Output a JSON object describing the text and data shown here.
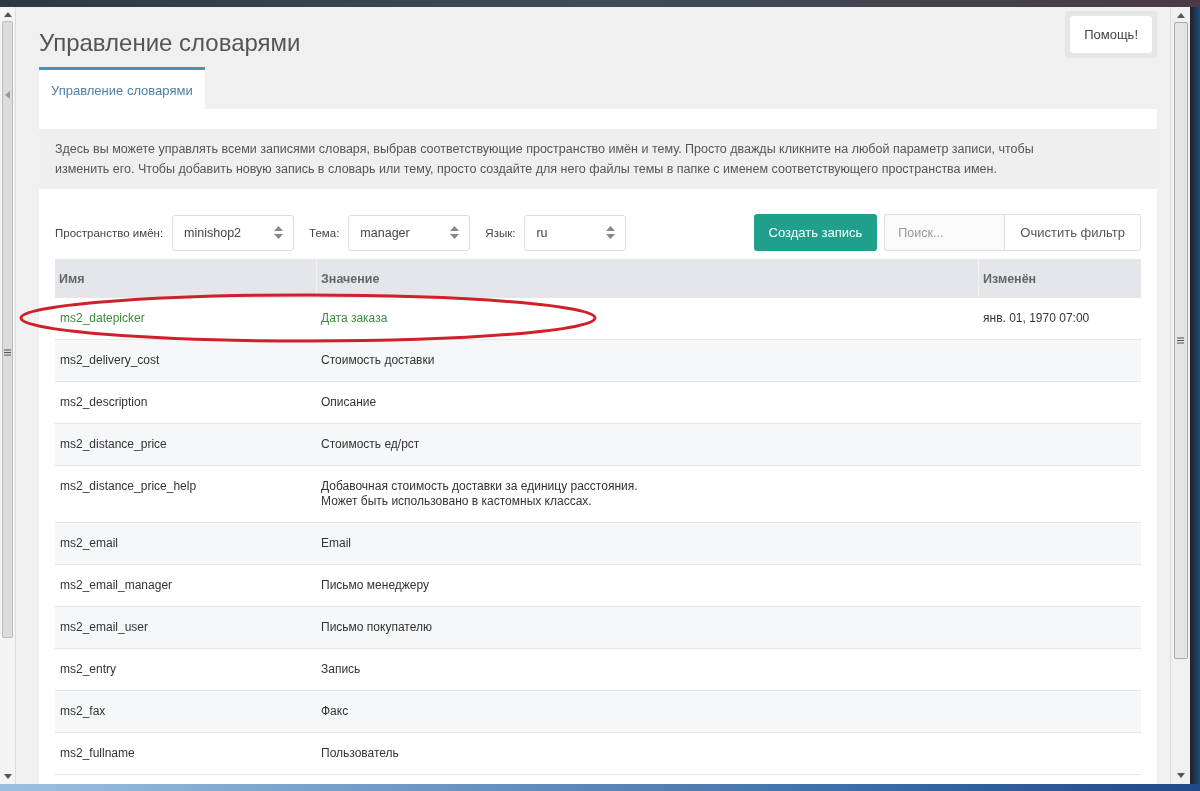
{
  "page": {
    "title": "Управление словарями",
    "help_button": "Помощь!"
  },
  "tabs": [
    {
      "label": "Управление словарями",
      "selected": true
    }
  ],
  "info": "Здесь вы можете управлять всеми записями словаря, выбрав соответствующие пространство имён и тему. Просто дважды кликните на любой параметр записи, чтобы изменить его. Чтобы добавить новую запись в словарь или тему, просто создайте для него файлы темы в папке с именем соответствующего пространства имен.",
  "filters": [
    {
      "label": "Пространство имён:",
      "value": "minishop2"
    },
    {
      "label": "Тема:",
      "value": "manager"
    },
    {
      "label": "Язык:",
      "value": "ru"
    }
  ],
  "create_button": "Создать запись",
  "search": {
    "placeholder": "Поиск..."
  },
  "clear_button": "Очистить фильтр",
  "table": {
    "columns": [
      "Имя",
      "Значение",
      "Изменён"
    ],
    "rows": [
      {
        "name": "ms2_datepicker",
        "value": "Дата заказа",
        "modified_at": "янв. 01, 1970 07:00",
        "modified": true
      },
      {
        "name": "ms2_delivery_cost",
        "value": "Стоимость доставки",
        "modified": false
      },
      {
        "name": "ms2_description",
        "value": "Описание",
        "modified": false
      },
      {
        "name": "ms2_distance_price",
        "value": "Стоимость ед/рст",
        "modified": false
      },
      {
        "name": "ms2_distance_price_help",
        "value": "Добавочная стоимость доставки за единицу расстояния.\nМожет быть использовано в кастомных классах.",
        "modified": false
      },
      {
        "name": "ms2_email",
        "value": "Email",
        "modified": false
      },
      {
        "name": "ms2_email_manager",
        "value": "Письмо менеджеру",
        "modified": false
      },
      {
        "name": "ms2_email_user",
        "value": "Письмо покупателю",
        "modified": false
      },
      {
        "name": "ms2_entry",
        "value": "Запись",
        "modified": false
      },
      {
        "name": "ms2_fax",
        "value": "Факс",
        "modified": false
      },
      {
        "name": "ms2_fullname",
        "value": "Пользователь",
        "modified": false
      }
    ]
  }
}
